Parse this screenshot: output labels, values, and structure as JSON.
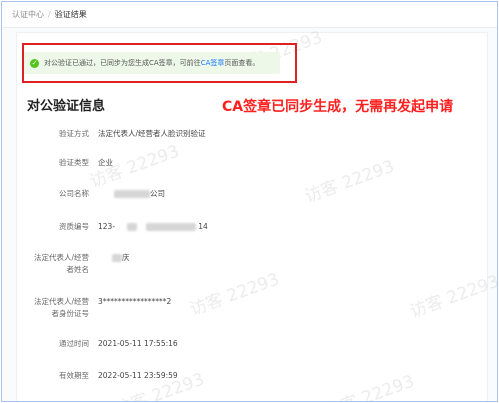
{
  "breadcrumb": {
    "parent": "认证中心",
    "separator": "/",
    "current": "验证结果"
  },
  "alert": {
    "text_before": "对公验证已通过，已同步为您生成CA签章，可前往",
    "link": "CA签章",
    "text_after": "页面查看。"
  },
  "section_title": "对公验证信息",
  "annotation": "CA签章已同步生成，无需再发起申请",
  "fields": {
    "method": {
      "label": "验证方式",
      "value": "法定代表人/经营者人脸识别验证"
    },
    "subject_type": {
      "label": "验证类型",
      "value": "企业"
    },
    "company": {
      "label": "公司名称",
      "value_suffix": "公司"
    },
    "qualification": {
      "label": "资质编号",
      "value_prefix": "123-",
      "value_suffix": "14"
    },
    "legal_name": {
      "label_line1": "法定代表人/经营",
      "label_line2": "者姓名",
      "value_suffix": "庆"
    },
    "legal_id": {
      "label_line1": "法定代表人/经营",
      "label_line2": "者身份证号",
      "value": "3*****************2"
    },
    "pass_time": {
      "label": "通过时间",
      "value": "2021-05-11 17:55:16"
    },
    "valid_until": {
      "label": "有效期至",
      "value": "2022-05-11 23:59:59"
    }
  },
  "watermark": "访客 22293",
  "colors": {
    "annotation_red": "#ff1f1f",
    "alert_bg": "#edf8e8",
    "success_green": "#52c41a",
    "link_blue": "#1677ff"
  }
}
